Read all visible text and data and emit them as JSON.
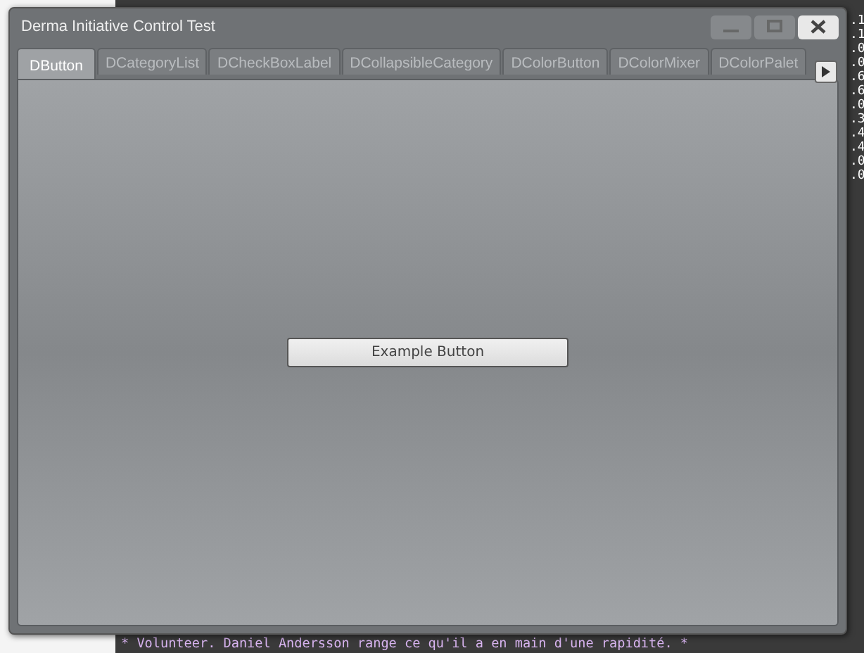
{
  "window": {
    "title": "Derma Initiative Control Test",
    "controls": [
      {
        "kind": "minimize",
        "disabled": true
      },
      {
        "kind": "maximize",
        "disabled": true
      },
      {
        "kind": "close",
        "disabled": false
      }
    ]
  },
  "tabs": [
    {
      "label": "DButton",
      "selected": true
    },
    {
      "label": "DCategoryList",
      "selected": false
    },
    {
      "label": "DCheckBoxLabel",
      "selected": false
    },
    {
      "label": "DCollapsibleCategory",
      "selected": false
    },
    {
      "label": "DColorButton",
      "selected": false
    },
    {
      "label": "DColorMixer",
      "selected": false
    },
    {
      "label": "DColorPalet",
      "selected": false
    }
  ],
  "panel": {
    "button": {
      "label": "Example Button"
    }
  },
  "console": {
    "side_column": [
      ".1",
      ".1",
      ".0",
      ".0",
      ".6",
      ".6",
      ".0",
      ".3",
      ".4",
      ".4",
      ".0",
      ".0"
    ],
    "bottom_line": "* Volunteer. Daniel Andersson range ce qu'il a en main d'une rapidité.  *"
  }
}
